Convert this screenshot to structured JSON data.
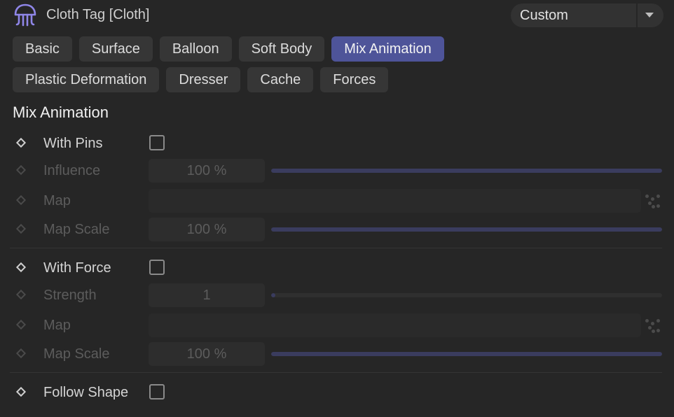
{
  "header": {
    "title": "Cloth Tag [Cloth]",
    "icon": "jellyfish-cloth-icon",
    "preset": {
      "value": "Custom"
    }
  },
  "tabs_row1": [
    {
      "label": "Basic",
      "active": false
    },
    {
      "label": "Surface",
      "active": false
    },
    {
      "label": "Balloon",
      "active": false
    },
    {
      "label": "Soft Body",
      "active": false
    },
    {
      "label": "Mix Animation",
      "active": true
    }
  ],
  "tabs_row2": [
    {
      "label": "Plastic Deformation",
      "active": false
    },
    {
      "label": "Dresser",
      "active": false
    },
    {
      "label": "Cache",
      "active": false
    },
    {
      "label": "Forces",
      "active": false
    }
  ],
  "section": {
    "title": "Mix Animation"
  },
  "pins": {
    "with_pins": {
      "label": "With Pins",
      "checked": false
    },
    "influence": {
      "label": "Influence",
      "value": "100 %",
      "fraction": 1.0
    },
    "map": {
      "label": "Map"
    },
    "map_scale": {
      "label": "Map Scale",
      "value": "100 %",
      "fraction": 1.0
    }
  },
  "force": {
    "with_force": {
      "label": "With Force",
      "checked": false
    },
    "strength": {
      "label": "Strength",
      "value": "1",
      "fraction": 0.01
    },
    "map": {
      "label": "Map"
    },
    "map_scale": {
      "label": "Map Scale",
      "value": "100 %",
      "fraction": 1.0
    }
  },
  "follow_shape": {
    "label": "Follow Shape",
    "checked": false
  },
  "colors": {
    "accent": "#4e5499",
    "slider_fill": "#3a3c5e",
    "background": "#262626"
  }
}
